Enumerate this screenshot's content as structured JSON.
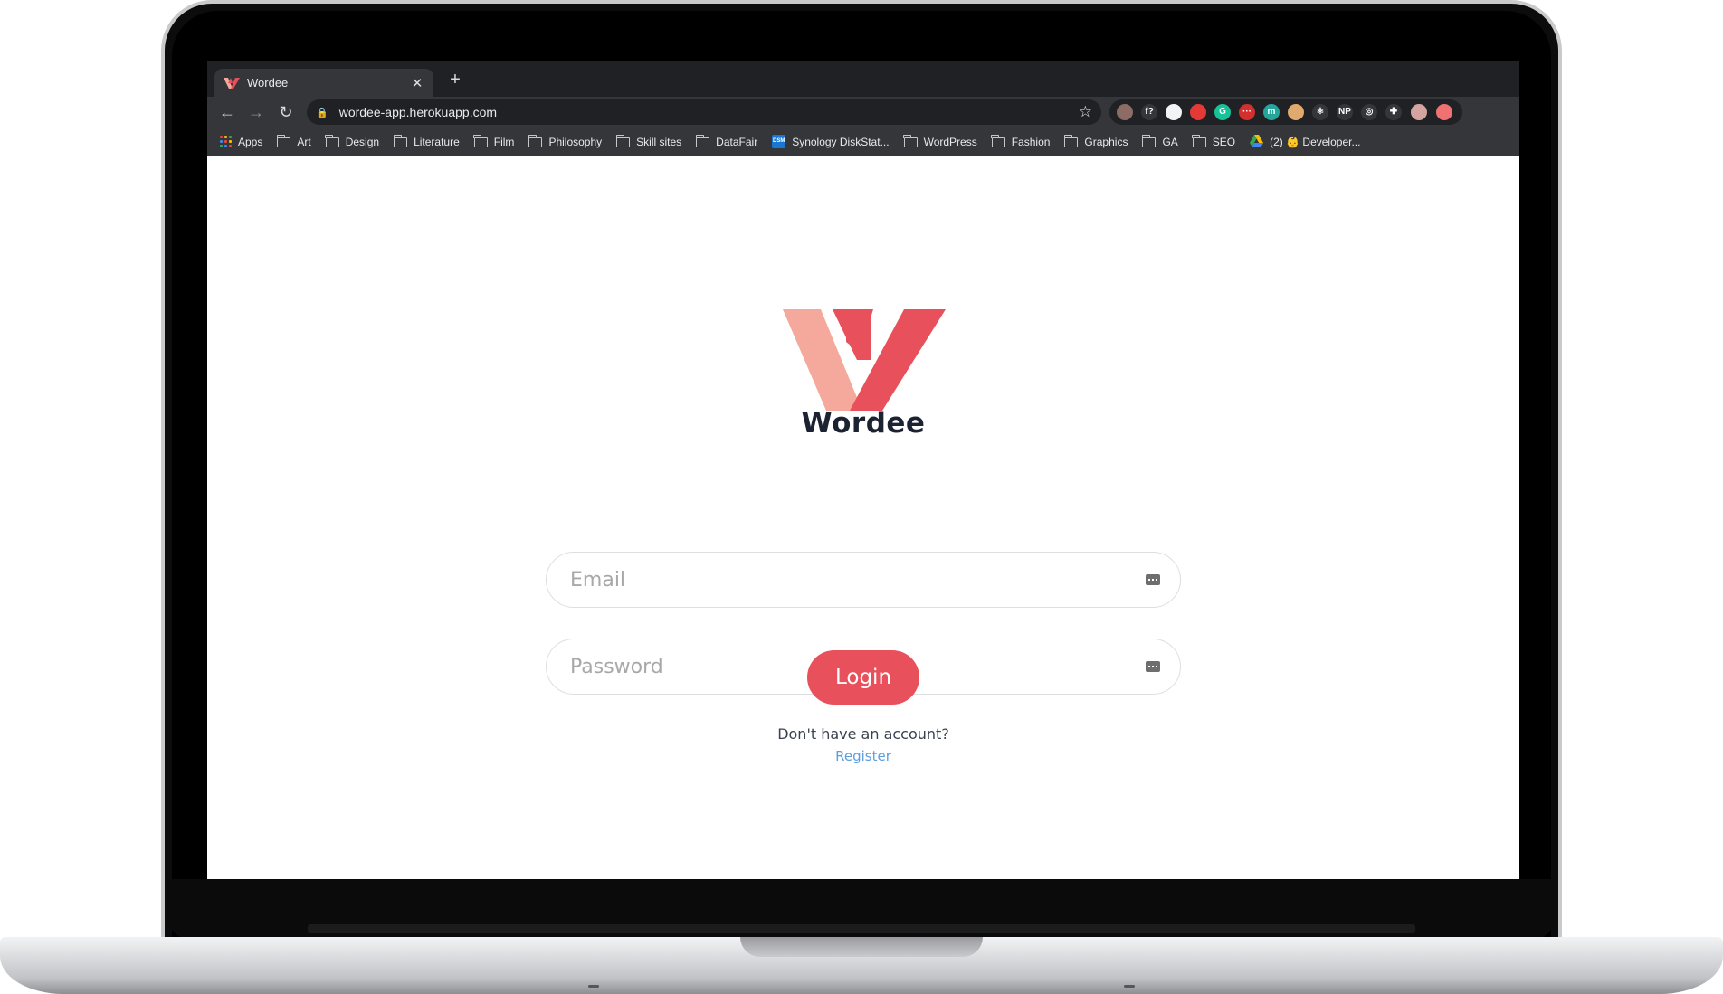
{
  "browser": {
    "tab_title": "Wordee",
    "tab_close": "✕",
    "new_tab": "+",
    "url": "wordee-app.herokuapp.com",
    "back": "←",
    "forward": "→",
    "reload": "↻",
    "lock": "🔒",
    "star": "☆",
    "extensions": [
      {
        "icon": "brown-circle-extension-icon",
        "label": "",
        "color": "#8c6c64"
      },
      {
        "icon": "font-extension-icon",
        "label": "f?",
        "color": "#35363a"
      },
      {
        "icon": "eyedropper-extension-icon",
        "label": "",
        "color": "#f1f3f4"
      },
      {
        "icon": "hand-extension-icon",
        "label": "",
        "color": "#e53935"
      },
      {
        "icon": "grammarly-extension-icon",
        "label": "G",
        "color": "#15c39a"
      },
      {
        "icon": "red-dots-extension-icon",
        "label": "···",
        "color": "#d32f2f"
      },
      {
        "icon": "m-extension-icon",
        "label": "m",
        "color": "#26a69a"
      },
      {
        "icon": "face-extension-icon",
        "label": "",
        "color": "#e0a96d"
      },
      {
        "icon": "react-extension-icon",
        "label": "⚛",
        "color": "#35363a"
      },
      {
        "icon": "np-extension-icon",
        "label": "NP",
        "color": "#35363a"
      },
      {
        "icon": "target-extension-icon",
        "label": "◎",
        "color": "#35363a"
      },
      {
        "icon": "puzzle-extensions-icon",
        "label": "✚",
        "color": "#35363a"
      },
      {
        "icon": "profile-avatar-icon",
        "label": "",
        "color": "#d4a5a0"
      },
      {
        "icon": "update-icon",
        "label": "",
        "color": "#f07171"
      }
    ]
  },
  "bookmarks": [
    {
      "label": "Apps",
      "icon": "apps-grid-icon"
    },
    {
      "label": "Art",
      "icon": "folder-icon"
    },
    {
      "label": "Design",
      "icon": "folder-icon"
    },
    {
      "label": "Literature",
      "icon": "folder-icon"
    },
    {
      "label": "Film",
      "icon": "folder-icon"
    },
    {
      "label": "Philosophy",
      "icon": "folder-icon"
    },
    {
      "label": "Skill sites",
      "icon": "folder-icon"
    },
    {
      "label": "DataFair",
      "icon": "folder-icon"
    },
    {
      "label": "Synology DiskStat...",
      "icon": "dsm-icon"
    },
    {
      "label": "WordPress",
      "icon": "folder-icon"
    },
    {
      "label": "Fashion",
      "icon": "folder-icon"
    },
    {
      "label": "Graphics",
      "icon": "folder-icon"
    },
    {
      "label": "GA",
      "icon": "folder-icon"
    },
    {
      "label": "SEO",
      "icon": "folder-icon"
    },
    {
      "label": "(2) 👶 Developer...",
      "icon": "drive-icon"
    }
  ],
  "page": {
    "brand_name": "Wordee",
    "email_placeholder": "Email",
    "password_placeholder": "Password",
    "login_label": "Login",
    "no_account_text": "Don't have an account?",
    "register_label": "Register"
  },
  "colors": {
    "brand_red": "#e8505b",
    "brand_pink": "#f4a99c",
    "brand_navy": "#1b2231",
    "link_blue": "#5d9ee0"
  }
}
